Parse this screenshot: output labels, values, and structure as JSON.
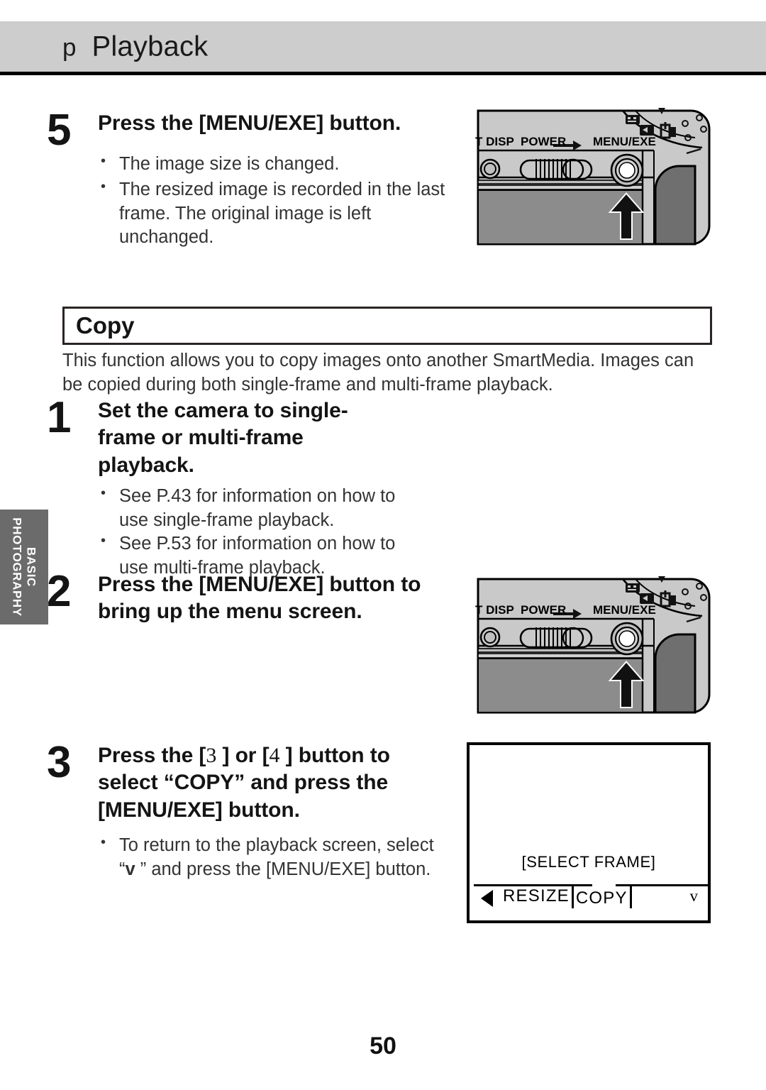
{
  "header": {
    "glyph": "p",
    "glyph_icon": "playback-mode-icon",
    "title": "Playback"
  },
  "side_tab": {
    "line1": "BASIC",
    "line2": "PHOTOGRAPHY",
    "color": "#6b6b6b"
  },
  "step5": {
    "number": "5",
    "title": "Press the [MENU/EXE] button.",
    "bullets": [
      "The image size is changed.",
      "The resized image is recorded in the last frame. The original image is left unchanged."
    ]
  },
  "section": {
    "heading": "Copy",
    "description": "This function allows you to copy images onto another SmartMedia. Images can be copied during both single-frame and multi-frame playback."
  },
  "step1": {
    "number": "1",
    "title": "Set the camera to single-frame or multi-frame playback.",
    "bullets": [
      "See P.43 for information on how to use single-frame playback.",
      "See P.53 for information on how to use multi-frame playback."
    ]
  },
  "step2": {
    "number": "2",
    "title": "Press the [MENU/EXE] button to bring up the menu screen."
  },
  "step3": {
    "number": "3",
    "title_part1": "Press the [",
    "title_sym1": "3",
    "title_part2": " ] or [",
    "title_sym2": "4",
    "title_part3": " ] button to select “COPY” and press the [MENU/EXE] button.",
    "bullet_part1": "To return to the playback screen, select “",
    "bullet_sym": "v",
    "bullet_part2": " ” and press the [MENU/EXE] button."
  },
  "camera_illustration": {
    "label_disp": "T DISP",
    "label_power": "POWER",
    "label_menu": "MENU / EXE",
    "body_top_color": "#c9c9c9",
    "body_bottom_color": "#8c8c8c",
    "grip_color": "#6f6f6f"
  },
  "lcd": {
    "title": "[SELECT FRAME]",
    "items": [
      "RESIZE",
      "COPY"
    ],
    "selected": "COPY",
    "down_marker": "v"
  },
  "page_number": "50"
}
